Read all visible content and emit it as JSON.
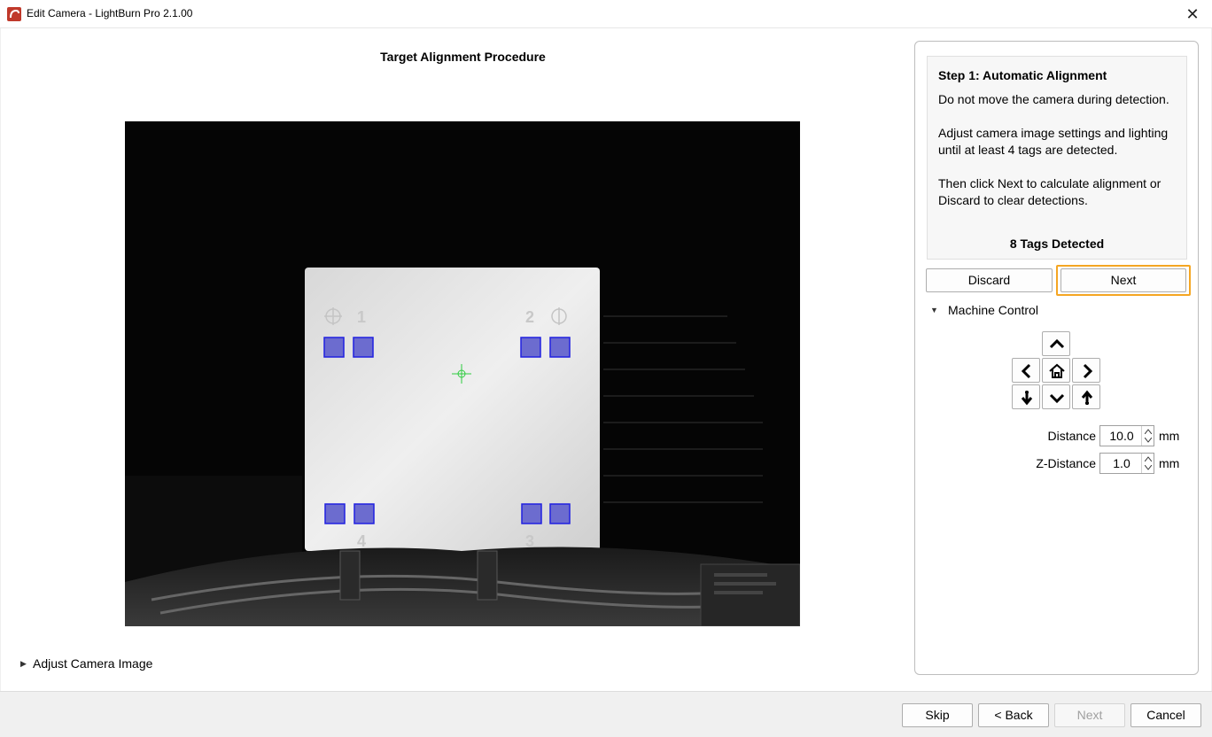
{
  "window": {
    "title": "Edit Camera - LightBurn Pro 2.1.00",
    "close_glyph": "✕"
  },
  "main": {
    "procedure_title": "Target Alignment Procedure",
    "adjust_camera_label": "Adjust Camera Image"
  },
  "step": {
    "heading": "Step 1: Automatic Alignment",
    "line1": "Do not move the camera during detection.",
    "line2": "Adjust camera image settings and lighting until at least 4 tags are detected.",
    "line3": "Then click Next to calculate alignment or Discard to clear detections.",
    "tags_detected": "8 Tags Detected"
  },
  "buttons": {
    "discard": "Discard",
    "next": "Next"
  },
  "machine_control": {
    "label": "Machine Control",
    "distance_label": "Distance",
    "distance_value": "10.0",
    "distance_unit": "mm",
    "z_distance_label": "Z-Distance",
    "z_distance_value": "1.0",
    "z_distance_unit": "mm"
  },
  "footer": {
    "skip": "Skip",
    "back": "< Back",
    "next": "Next",
    "cancel": "Cancel"
  },
  "colors": {
    "highlight": "#f5a623",
    "tag_box": "#3b3bd6",
    "crosshair": "#2ecc40"
  },
  "camera_markers": [
    "1",
    "2",
    "3",
    "4"
  ]
}
